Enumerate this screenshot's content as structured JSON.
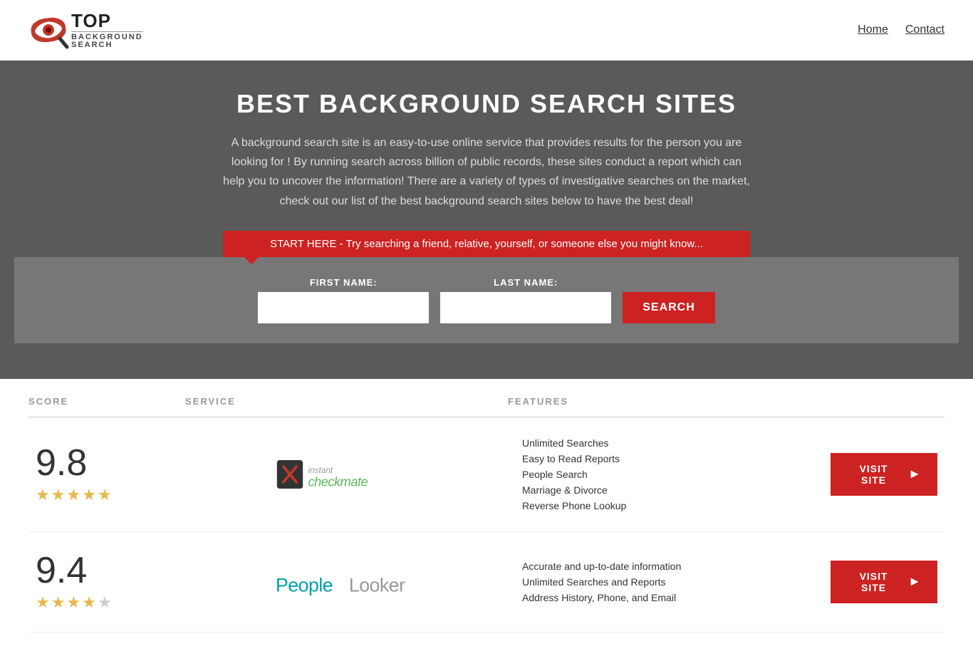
{
  "header": {
    "logo_top": "TOP",
    "logo_sub": "BACKGROUND\nSEARCH",
    "nav": [
      {
        "label": "Home",
        "href": "#"
      },
      {
        "label": "Contact",
        "href": "#"
      }
    ]
  },
  "hero": {
    "title": "BEST BACKGROUND SEARCH SITES",
    "description": "A background search site is an easy-to-use online service that provides results  for the person you are looking for ! By  running  search across billion of public records, these sites conduct  a report which can help you to uncover the information! There are a variety of types of investigative searches on the market, check out our  list of the best background search sites below to have the best deal!",
    "callout": "START HERE - Try searching a friend, relative, yourself, or someone else you might know..."
  },
  "search_form": {
    "first_name_label": "FIRST NAME:",
    "last_name_label": "LAST NAME:",
    "button_label": "SEARCH"
  },
  "table": {
    "columns": [
      "SCORE",
      "SERVICE",
      "FEATURES",
      ""
    ],
    "rows": [
      {
        "score": "9.8",
        "stars": 4.5,
        "service_name": "InstantCheckmate",
        "features": [
          "Unlimited Searches",
          "Easy to Read Reports",
          "People Search",
          "Marriage & Divorce",
          "Reverse Phone Lookup"
        ],
        "visit_label": "VISIT SITE"
      },
      {
        "score": "9.4",
        "stars": 4,
        "service_name": "PeopleLooker",
        "features": [
          "Accurate and up-to-date information",
          "Unlimited Searches and Reports",
          "Address History, Phone, and Email"
        ],
        "visit_label": "VISIT SITE"
      }
    ]
  }
}
